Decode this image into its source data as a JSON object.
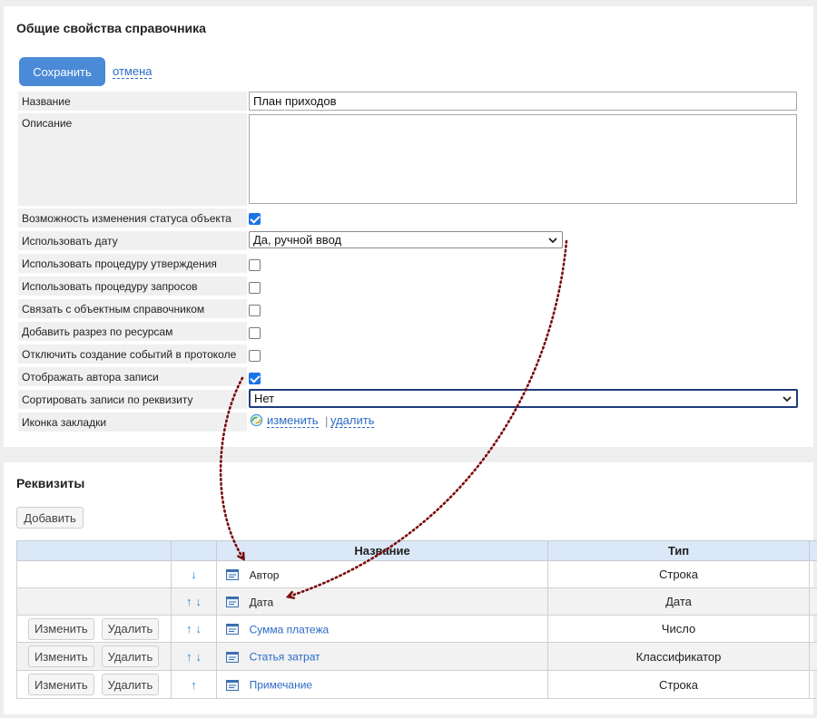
{
  "general": {
    "title": "Общие свойства справочника",
    "save_label": "Сохранить",
    "cancel_label": "отмена",
    "fields": [
      {
        "label": "Название"
      },
      {
        "label": "Описание"
      },
      {
        "label": "Возможность изменения статуса объекта",
        "checked": true
      },
      {
        "label": "Использовать дату"
      },
      {
        "label": "Использовать процедуру утверждения",
        "checked": false
      },
      {
        "label": "Использовать процедуру запросов",
        "checked": false
      },
      {
        "label": "Связать с объектным справочником",
        "checked": false
      },
      {
        "label": "Добавить разрез по ресурсам",
        "checked": false
      },
      {
        "label": "Отключить создание событий в протоколе",
        "checked": false
      },
      {
        "label": "Отображать автора записи",
        "checked": true
      },
      {
        "label": "Сортировать записи по реквизиту"
      },
      {
        "label": "Иконка закладки"
      }
    ],
    "name_value": "План приходов",
    "description_value": "",
    "date_select": "Да, ручной ввод",
    "sort_select": "Нет",
    "icon_change_label": "изменить",
    "icon_sep": "|",
    "icon_delete_label": "удалить"
  },
  "requisites": {
    "title": "Реквизиты",
    "add_label": "Добавить",
    "columns": [
      "",
      "",
      "Название",
      "Тип",
      ""
    ],
    "edit_label": "Изменить",
    "delete_label": "Удалить",
    "rows": [
      {
        "name": "Автор",
        "type": "Строка",
        "arrows": [
          "↓"
        ],
        "editable": false
      },
      {
        "name": "Дата",
        "type": "Дата",
        "arrows": [
          "↑",
          "↓"
        ],
        "editable": false
      },
      {
        "name": "Сумма платежа",
        "type": "Число",
        "arrows": [
          "↑",
          "↓"
        ],
        "editable": true
      },
      {
        "name": "Статья затрат",
        "type": "Классификатор",
        "arrows": [
          "↑",
          "↓"
        ],
        "editable": true
      },
      {
        "name": "Примечание",
        "type": "Строка",
        "arrows": [
          "↑"
        ],
        "editable": true
      }
    ]
  },
  "colors": {
    "primary": "#4a8ad6",
    "link": "#2a6ac6",
    "header_bg": "#dbe8f7",
    "annotation_arrow": "#7a0a0a"
  },
  "icons": {
    "chevron": "chevron-down-icon",
    "bookmark_icon": "refresh-globe-icon",
    "field_icon": "field-form-icon",
    "arrow_up": "arrow-up-icon",
    "arrow_down": "arrow-down-icon"
  }
}
